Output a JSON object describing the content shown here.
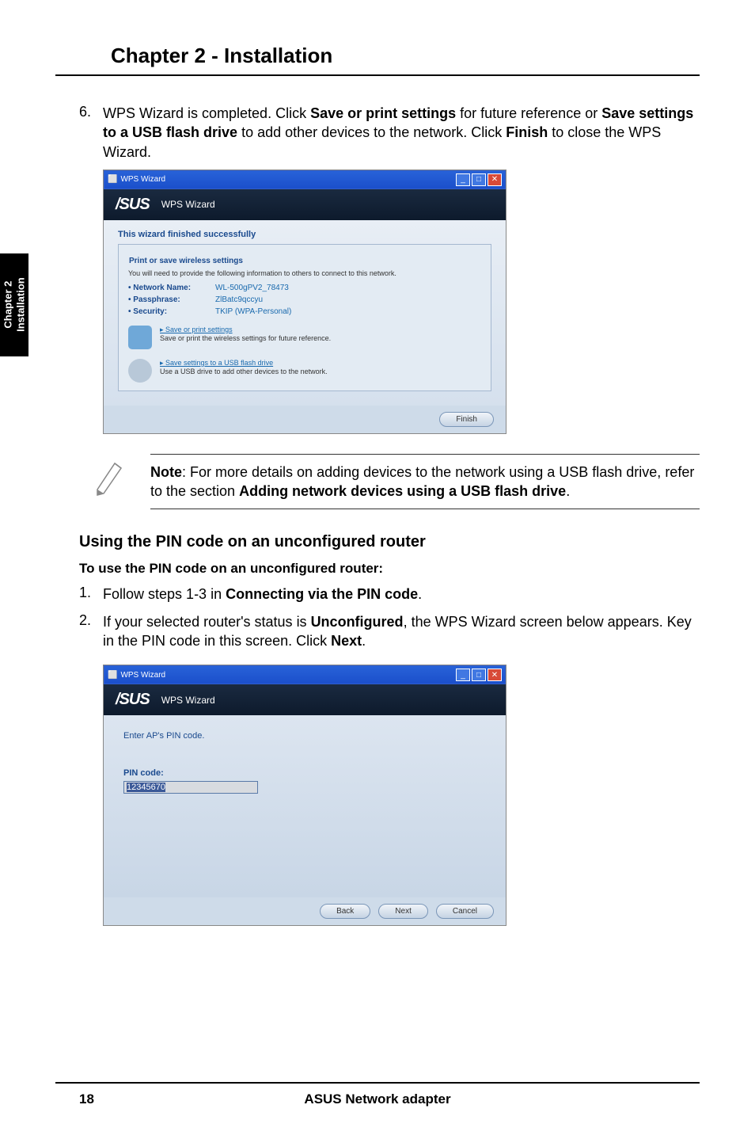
{
  "chapter_title": "Chapter 2 - Installation",
  "side_tab": {
    "line1": "Chapter 2",
    "line2": "Installation"
  },
  "step6": {
    "num": "6.",
    "text_before": "WPS Wizard is completed. Click ",
    "bold1": "Save or print settings",
    "text_mid1": " for future reference or ",
    "bold2": "Save settings to a USB flash drive",
    "text_mid2": " to add other devices to the network. Click ",
    "bold3": "Finish",
    "text_end": " to close the WPS Wizard."
  },
  "screenshot1": {
    "titlebar": "WPS Wizard",
    "asus_sub": "WPS Wizard",
    "heading": "This wizard finished successfully",
    "legend": "Print or save wireless settings",
    "desc": "You will need to provide the following information to others to connect to this network.",
    "rows": [
      {
        "key": "• Network Name:",
        "val": "WL-500gPV2_78473"
      },
      {
        "key": "• Passphrase:",
        "val": "ZlBatc9qccyu"
      },
      {
        "key": "• Security:",
        "val": "TKIP (WPA-Personal)"
      }
    ],
    "action1_link": "Save or print settings",
    "action1_desc": "Save or print the wireless settings for future reference.",
    "action2_link": "Save settings to a USB flash drive",
    "action2_desc": "Use a USB drive to add other devices to the network.",
    "finish_btn": "Finish"
  },
  "note": {
    "bold_label": "Note",
    "text1": ": For more details on adding devices to the network using a USB flash drive, refer to the section ",
    "bold_section": "Adding network devices using a USB flash drive",
    "text2": "."
  },
  "section_heading": "Using the PIN code on an unconfigured router",
  "section_sub": "To use the PIN code on an unconfigured router:",
  "step1": {
    "num": "1.",
    "text_before": "Follow steps 1-3 in ",
    "bold1": "Connecting via the PIN code",
    "text_end": "."
  },
  "step2": {
    "num": "2.",
    "text_before": "If your selected router's status is ",
    "bold1": "Unconfigured",
    "text_mid": ", the WPS Wizard screen below appears. Key in the PIN code in this screen. Click ",
    "bold2": "Next",
    "text_end": "."
  },
  "screenshot2": {
    "titlebar": "WPS Wizard",
    "asus_sub": "WPS Wizard",
    "body_text": "Enter AP's PIN code.",
    "pin_label": "PIN code:",
    "pin_value": "12345670",
    "back_btn": "Back",
    "next_btn": "Next",
    "cancel_btn": "Cancel"
  },
  "footer": {
    "page_num": "18",
    "title": "ASUS Network adapter"
  }
}
